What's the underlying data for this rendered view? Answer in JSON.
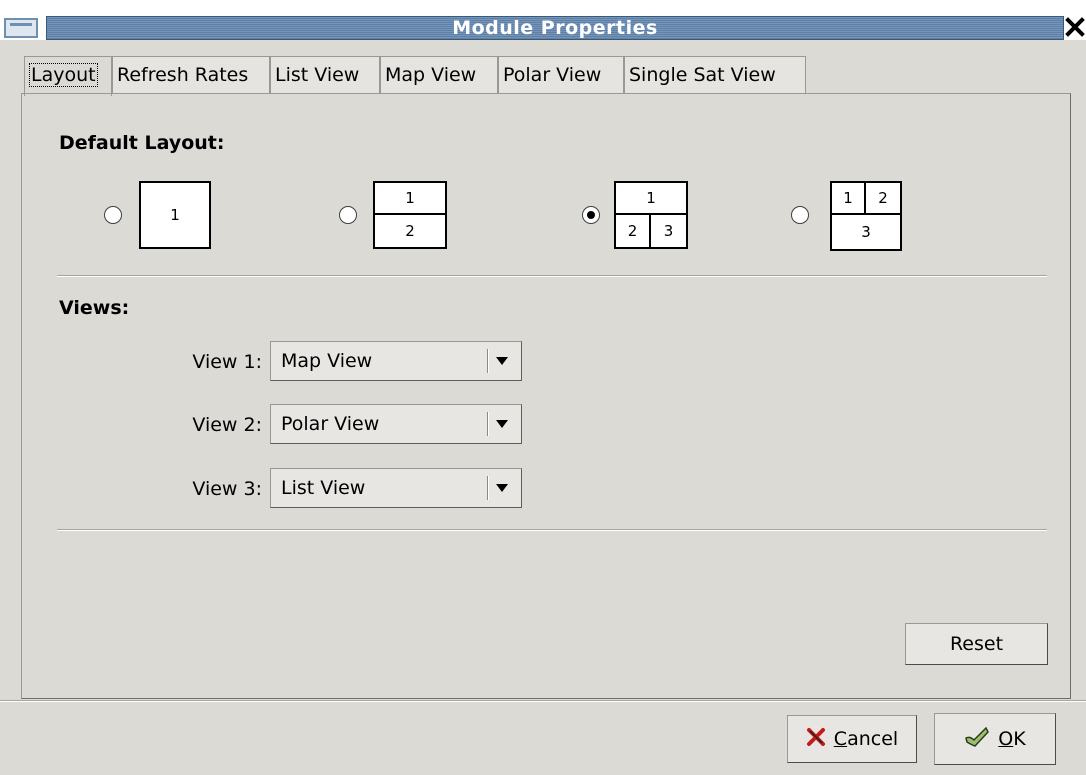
{
  "window": {
    "title": "Module Properties",
    "close_glyph": "✕"
  },
  "tabs": [
    {
      "label": "Layout",
      "active": true
    },
    {
      "label": "Refresh Rates",
      "active": false
    },
    {
      "label": "List View",
      "active": false
    },
    {
      "label": "Map View",
      "active": false
    },
    {
      "label": "Polar View",
      "active": false
    },
    {
      "label": "Single Sat View",
      "active": false
    }
  ],
  "layout_section": {
    "heading": "Default Layout:",
    "options": [
      {
        "cells": [
          "1"
        ],
        "selected": false
      },
      {
        "cells": [
          "1",
          "2"
        ],
        "selected": false
      },
      {
        "cells": [
          "1",
          "2",
          "3"
        ],
        "selected": true
      },
      {
        "cells": [
          "1",
          "2",
          "3"
        ],
        "selected": false
      }
    ]
  },
  "views_section": {
    "heading": "Views:",
    "rows": [
      {
        "label": "View 1:",
        "value": "Map View"
      },
      {
        "label": "View 2:",
        "value": "Polar View"
      },
      {
        "label": "View 3:",
        "value": "List View"
      }
    ]
  },
  "buttons": {
    "reset": "Reset",
    "cancel": "Cancel",
    "ok": "OK"
  },
  "icons": {
    "cancel": "x-icon",
    "ok": "check-icon",
    "window_menu": "window-menu-icon"
  }
}
